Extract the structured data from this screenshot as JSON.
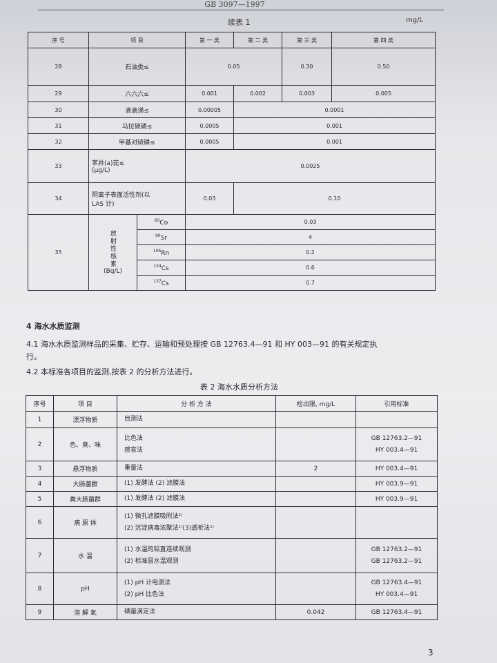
{
  "header": {
    "code": "GB 3097—1997",
    "continued": "续表 1",
    "unit": "mg/L"
  },
  "table1": {
    "head": [
      "序 号",
      "项 目",
      "第 一 类",
      "第 二 类",
      "第 三 类",
      "第 四 类"
    ],
    "rows": {
      "r28": {
        "no": "28",
        "item": "石油类≤",
        "v12": "0.05",
        "v3": "0.30",
        "v4": "0.50"
      },
      "r29": {
        "no": "29",
        "item": "六六六≤",
        "v1": "0.001",
        "v2": "0.002",
        "v3": "0.003",
        "v4": "0.005"
      },
      "r30": {
        "no": "30",
        "item": "滴滴涕≤",
        "v1": "0.00005",
        "v234": "0.0001"
      },
      "r31": {
        "no": "31",
        "item": "马拉硫磷≤",
        "v1": "0.0005",
        "v234": "0.001"
      },
      "r32": {
        "no": "32",
        "item": "甲基对硫磷≤",
        "v1": "0.0005",
        "v234": "0.001"
      },
      "r33": {
        "no": "33",
        "item1": "苯并(a)芘≤",
        "item2": "(μg/L)",
        "vall": "0.0025"
      },
      "r34": {
        "no": "34",
        "item1": "阴离子表面活性剂(以",
        "item2": "LAS 计)",
        "v1": "0.03",
        "v234": "0.10"
      },
      "r35": {
        "no": "35",
        "group": "放射性核素",
        "group_unit": "(Bq/L)",
        "nuclides": [
          {
            "sup": "60",
            "sym": "Co",
            "val": "0.03"
          },
          {
            "sup": "90",
            "sym": "Sr",
            "val": "4"
          },
          {
            "sup": "106",
            "sym": "Rn",
            "val": "0.2"
          },
          {
            "sup": "134",
            "sym": "Cs",
            "val": "0.6"
          },
          {
            "sup": "137",
            "sym": "Cs",
            "val": "0.7"
          }
        ]
      }
    }
  },
  "section4": {
    "title": "4 海水水质监测",
    "p1_line1": "4.1  海水水质监测样品的采集、贮存、运输和预处理按 GB 12763.4—91 和 HY 003—91 的有关规定执",
    "p1_line2": "行。",
    "p2": "4.2  本标准各项目的监测,按表 2 的分析方法进行。"
  },
  "table2": {
    "caption": "表 2  海水水质分析方法",
    "head": [
      "序号",
      "项 目",
      "分 析 方 法",
      "检出限, mg/L",
      "引用标准"
    ],
    "rows": {
      "r1": {
        "no": "1",
        "item": "漂浮物质",
        "m1": "目测法",
        "limit": "",
        "s1": ""
      },
      "r2": {
        "no": "2",
        "item": "色、臭、味",
        "m1": "比色法",
        "m2": "感官法",
        "limit": "",
        "s1": "GB 12763.2—91",
        "s2": "HY 003.4—91"
      },
      "r3": {
        "no": "3",
        "item": "悬浮物质",
        "m1": "重量法",
        "limit": "2",
        "s1": "HY 003.4—91"
      },
      "r4": {
        "no": "4",
        "item": "大肠菌群",
        "m1": "(1)  发酵法  (2)  滤膜法",
        "limit": "",
        "s1": "HY 003.9—91"
      },
      "r5": {
        "no": "5",
        "item": "粪大肠菌群",
        "m1": "(1)  发酵法  (2)  滤膜法",
        "limit": "",
        "s1": "HY 003.9—91"
      },
      "r6": {
        "no": "6",
        "item": "病 原 体",
        "m1": "(1)  微孔滤膜吸附法¹⁾",
        "m2": "(2)  沉淀病毒浓聚法¹⁾(3)透析法¹⁾",
        "limit": "",
        "s1": ""
      },
      "r7": {
        "no": "7",
        "item": "水  温",
        "m1": "(1)  水温的铅直连续观测",
        "m2": "(2)  标准层水温观测",
        "limit": "",
        "s1": "GB 12763.2—91",
        "s2": "GB 12763.2—91"
      },
      "r8": {
        "no": "8",
        "item": "pH",
        "m1": "(1)  pH 计电测法",
        "m2": "(2)  pH 比色法",
        "limit": "",
        "s1": "GB 12763.4—91",
        "s2": "HY 003.4—91"
      },
      "r9": {
        "no": "9",
        "item": "溶 解 氧",
        "m1": "碘量滴定法",
        "limit": "0.042",
        "s1": "GB 12763.4—91"
      }
    }
  },
  "page_number": "3"
}
